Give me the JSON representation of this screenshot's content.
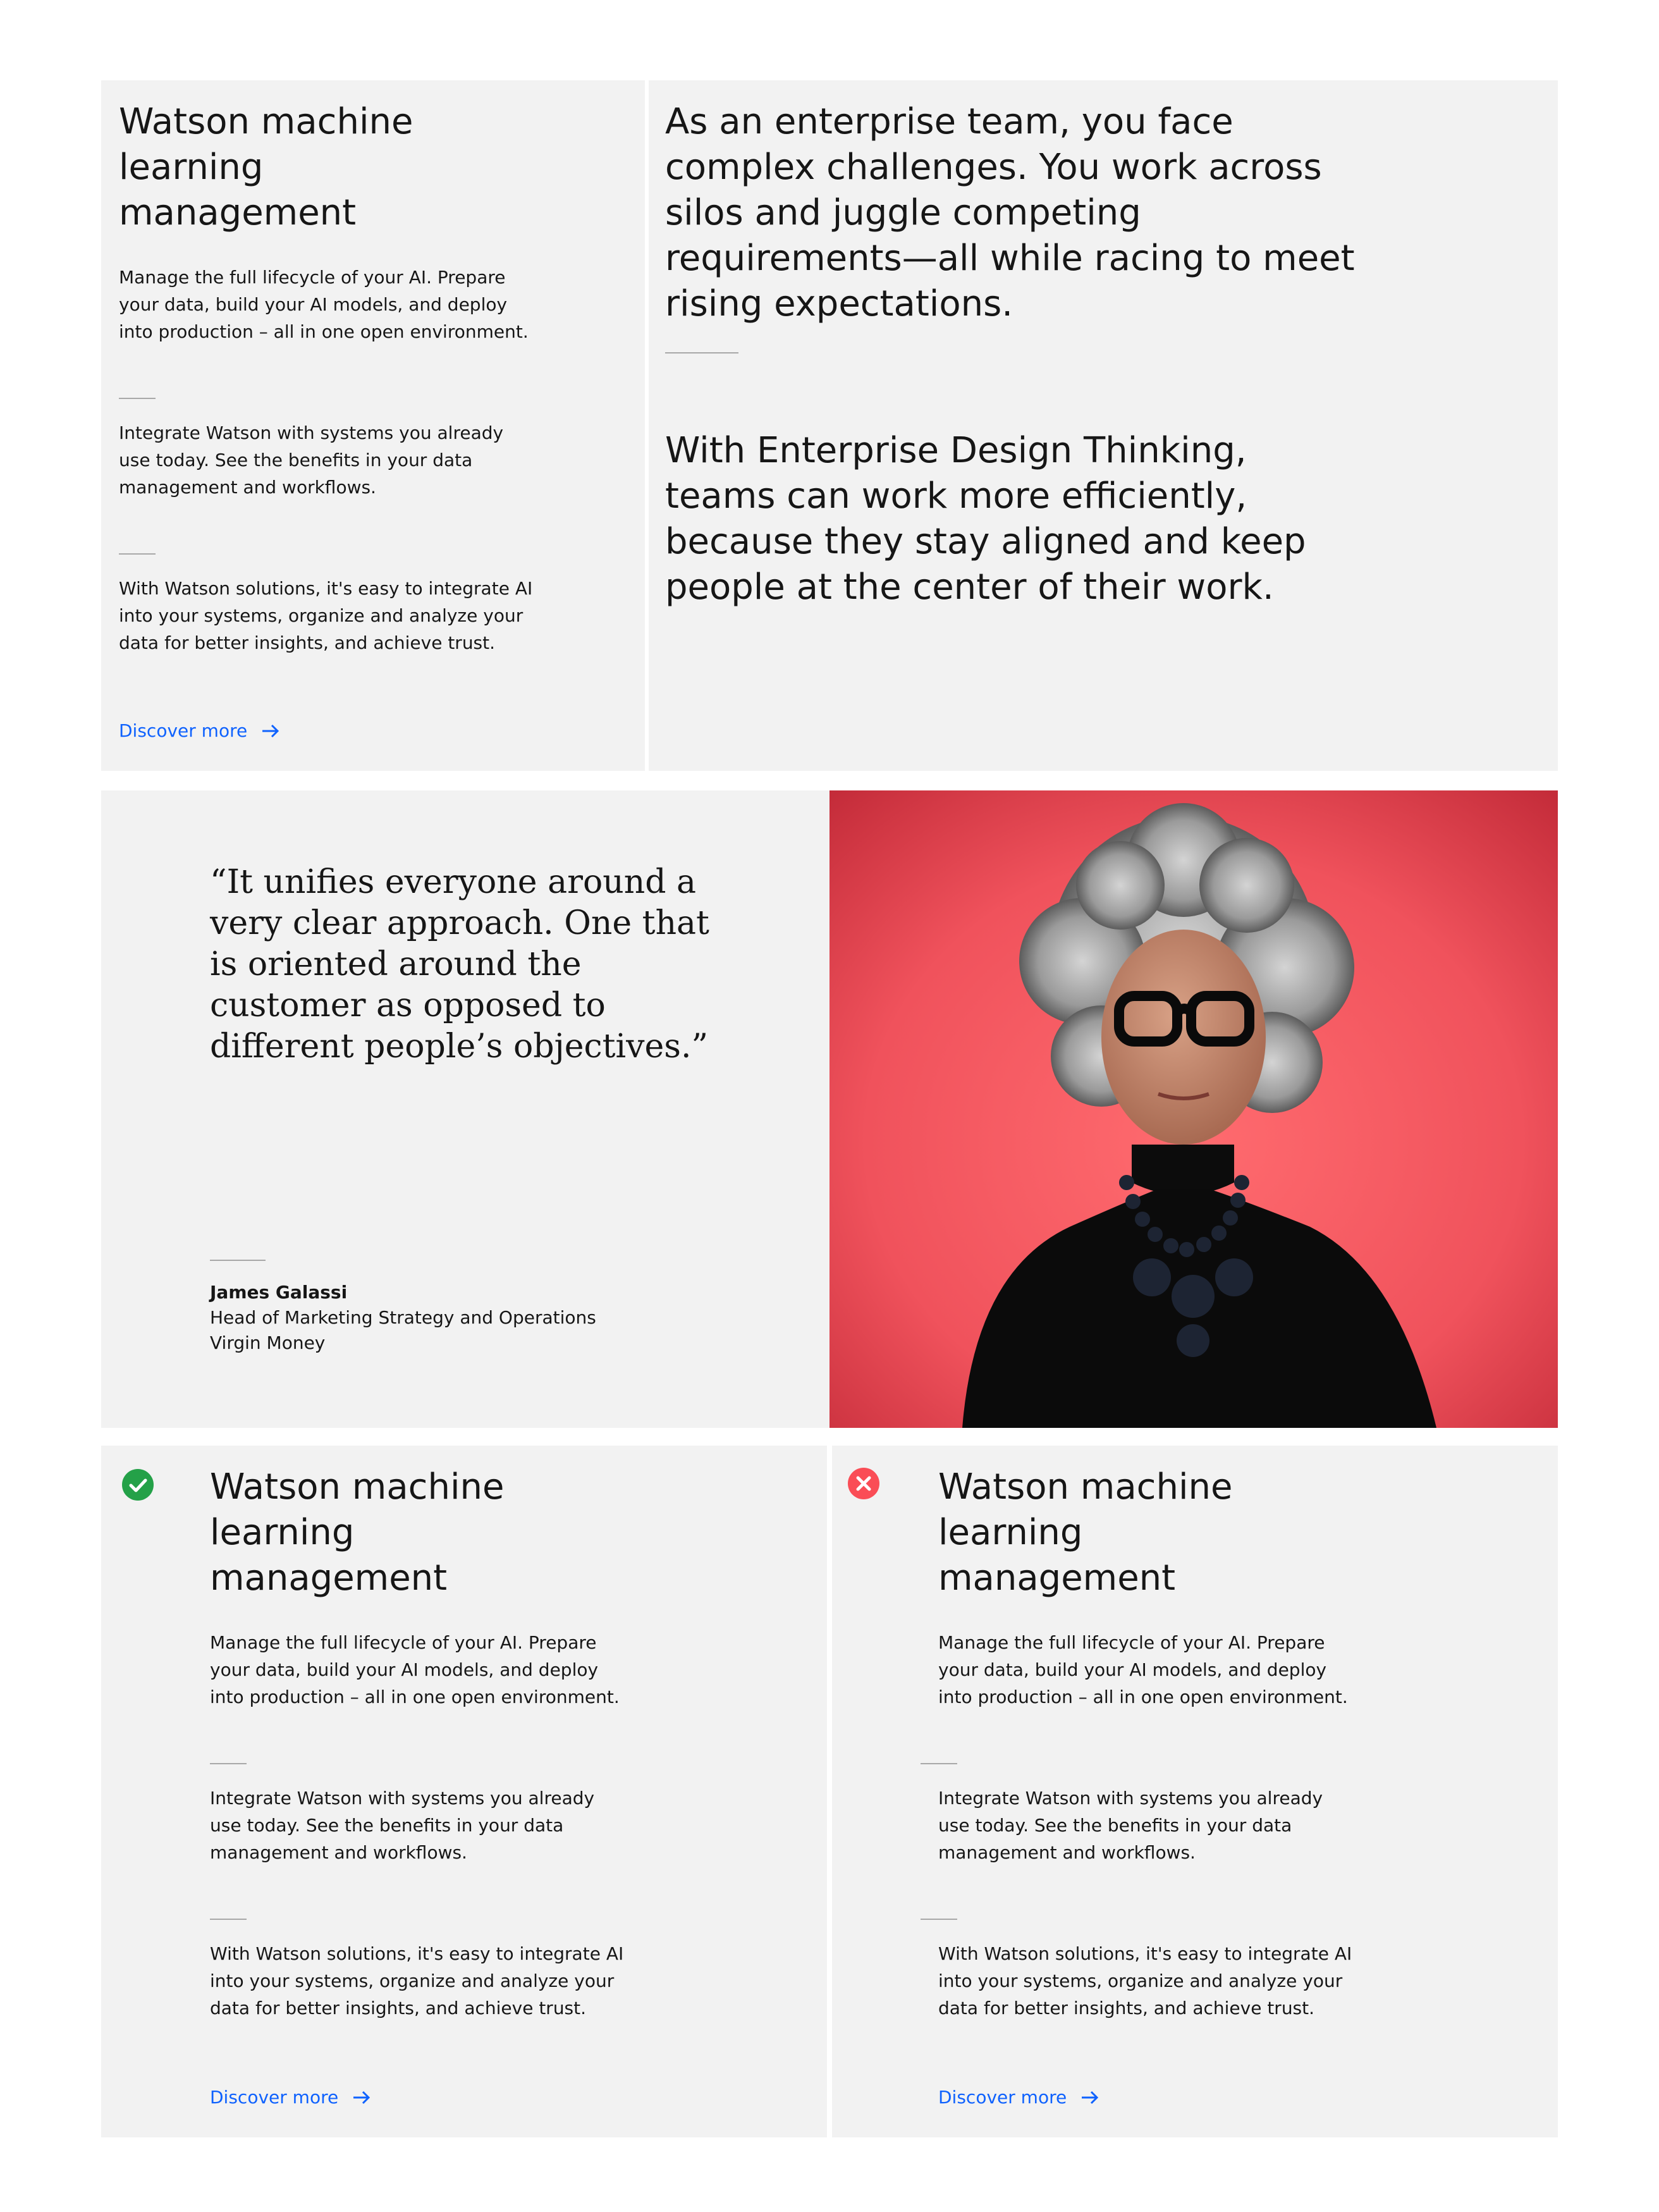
{
  "top_left_card": {
    "title": "Watson machine learning management",
    "paragraphs": [
      "Manage the full lifecycle of your AI. Prepare your data, build your AI models, and deploy into production – all in one open environment.",
      "Integrate Watson with systems you already use today. See the benefits in your data management and workflows.",
      "With Watson solutions, it's easy to integrate AI into your systems, organize and analyze your data for better insights, and achieve trust."
    ],
    "link_label": "Discover more"
  },
  "top_right_card": {
    "statement_1": "As an enterprise team, you face complex challenges. You work across silos and juggle competing requirements—all while racing to meet rising expectations.",
    "statement_2": "With Enterprise Design Thinking, teams can work more efficiently, because they stay aligned and keep people at the center of their work."
  },
  "testimonial": {
    "quote": "“It unifies everyone around a very clear approach. One that is oriented around the customer as opposed to different people’s objectives.”",
    "name": "James Galassi",
    "role": "Head of Marketing Strategy and Operations",
    "company": "Virgin Money",
    "photo_background": "#e2414f"
  },
  "do_card": {
    "status": "check-circle-icon",
    "status_color": "#24a148",
    "title": "Watson machine learning management",
    "paragraphs": [
      "Manage the full lifecycle of your AI. Prepare your data, build your AI models, and deploy into production – all in one open environment.",
      "Integrate Watson with systems you already use today. See the benefits in your data management and workflows.",
      "With Watson solutions, it's easy to integrate AI into your systems, organize and analyze your data for better insights, and achieve trust."
    ],
    "link_label": "Discover more"
  },
  "dont_card": {
    "status": "error-circle-icon",
    "status_color": "#fa4d56",
    "title": "Watson machine learning management",
    "paragraphs": [
      "Manage the full lifecycle of your AI. Prepare your data, build your AI models, and deploy into production – all in one open environment.",
      "Integrate Watson with systems you already use today. See the benefits in your data management and workflows.",
      "With Watson solutions, it's easy to integrate AI into your systems, organize and analyze your data for better insights, and achieve trust."
    ],
    "link_label": "Discover more"
  },
  "colors": {
    "panel_bg": "#f2f2f2",
    "link": "#0f62fe",
    "text": "#161616",
    "divider": "#a8a8a8"
  }
}
